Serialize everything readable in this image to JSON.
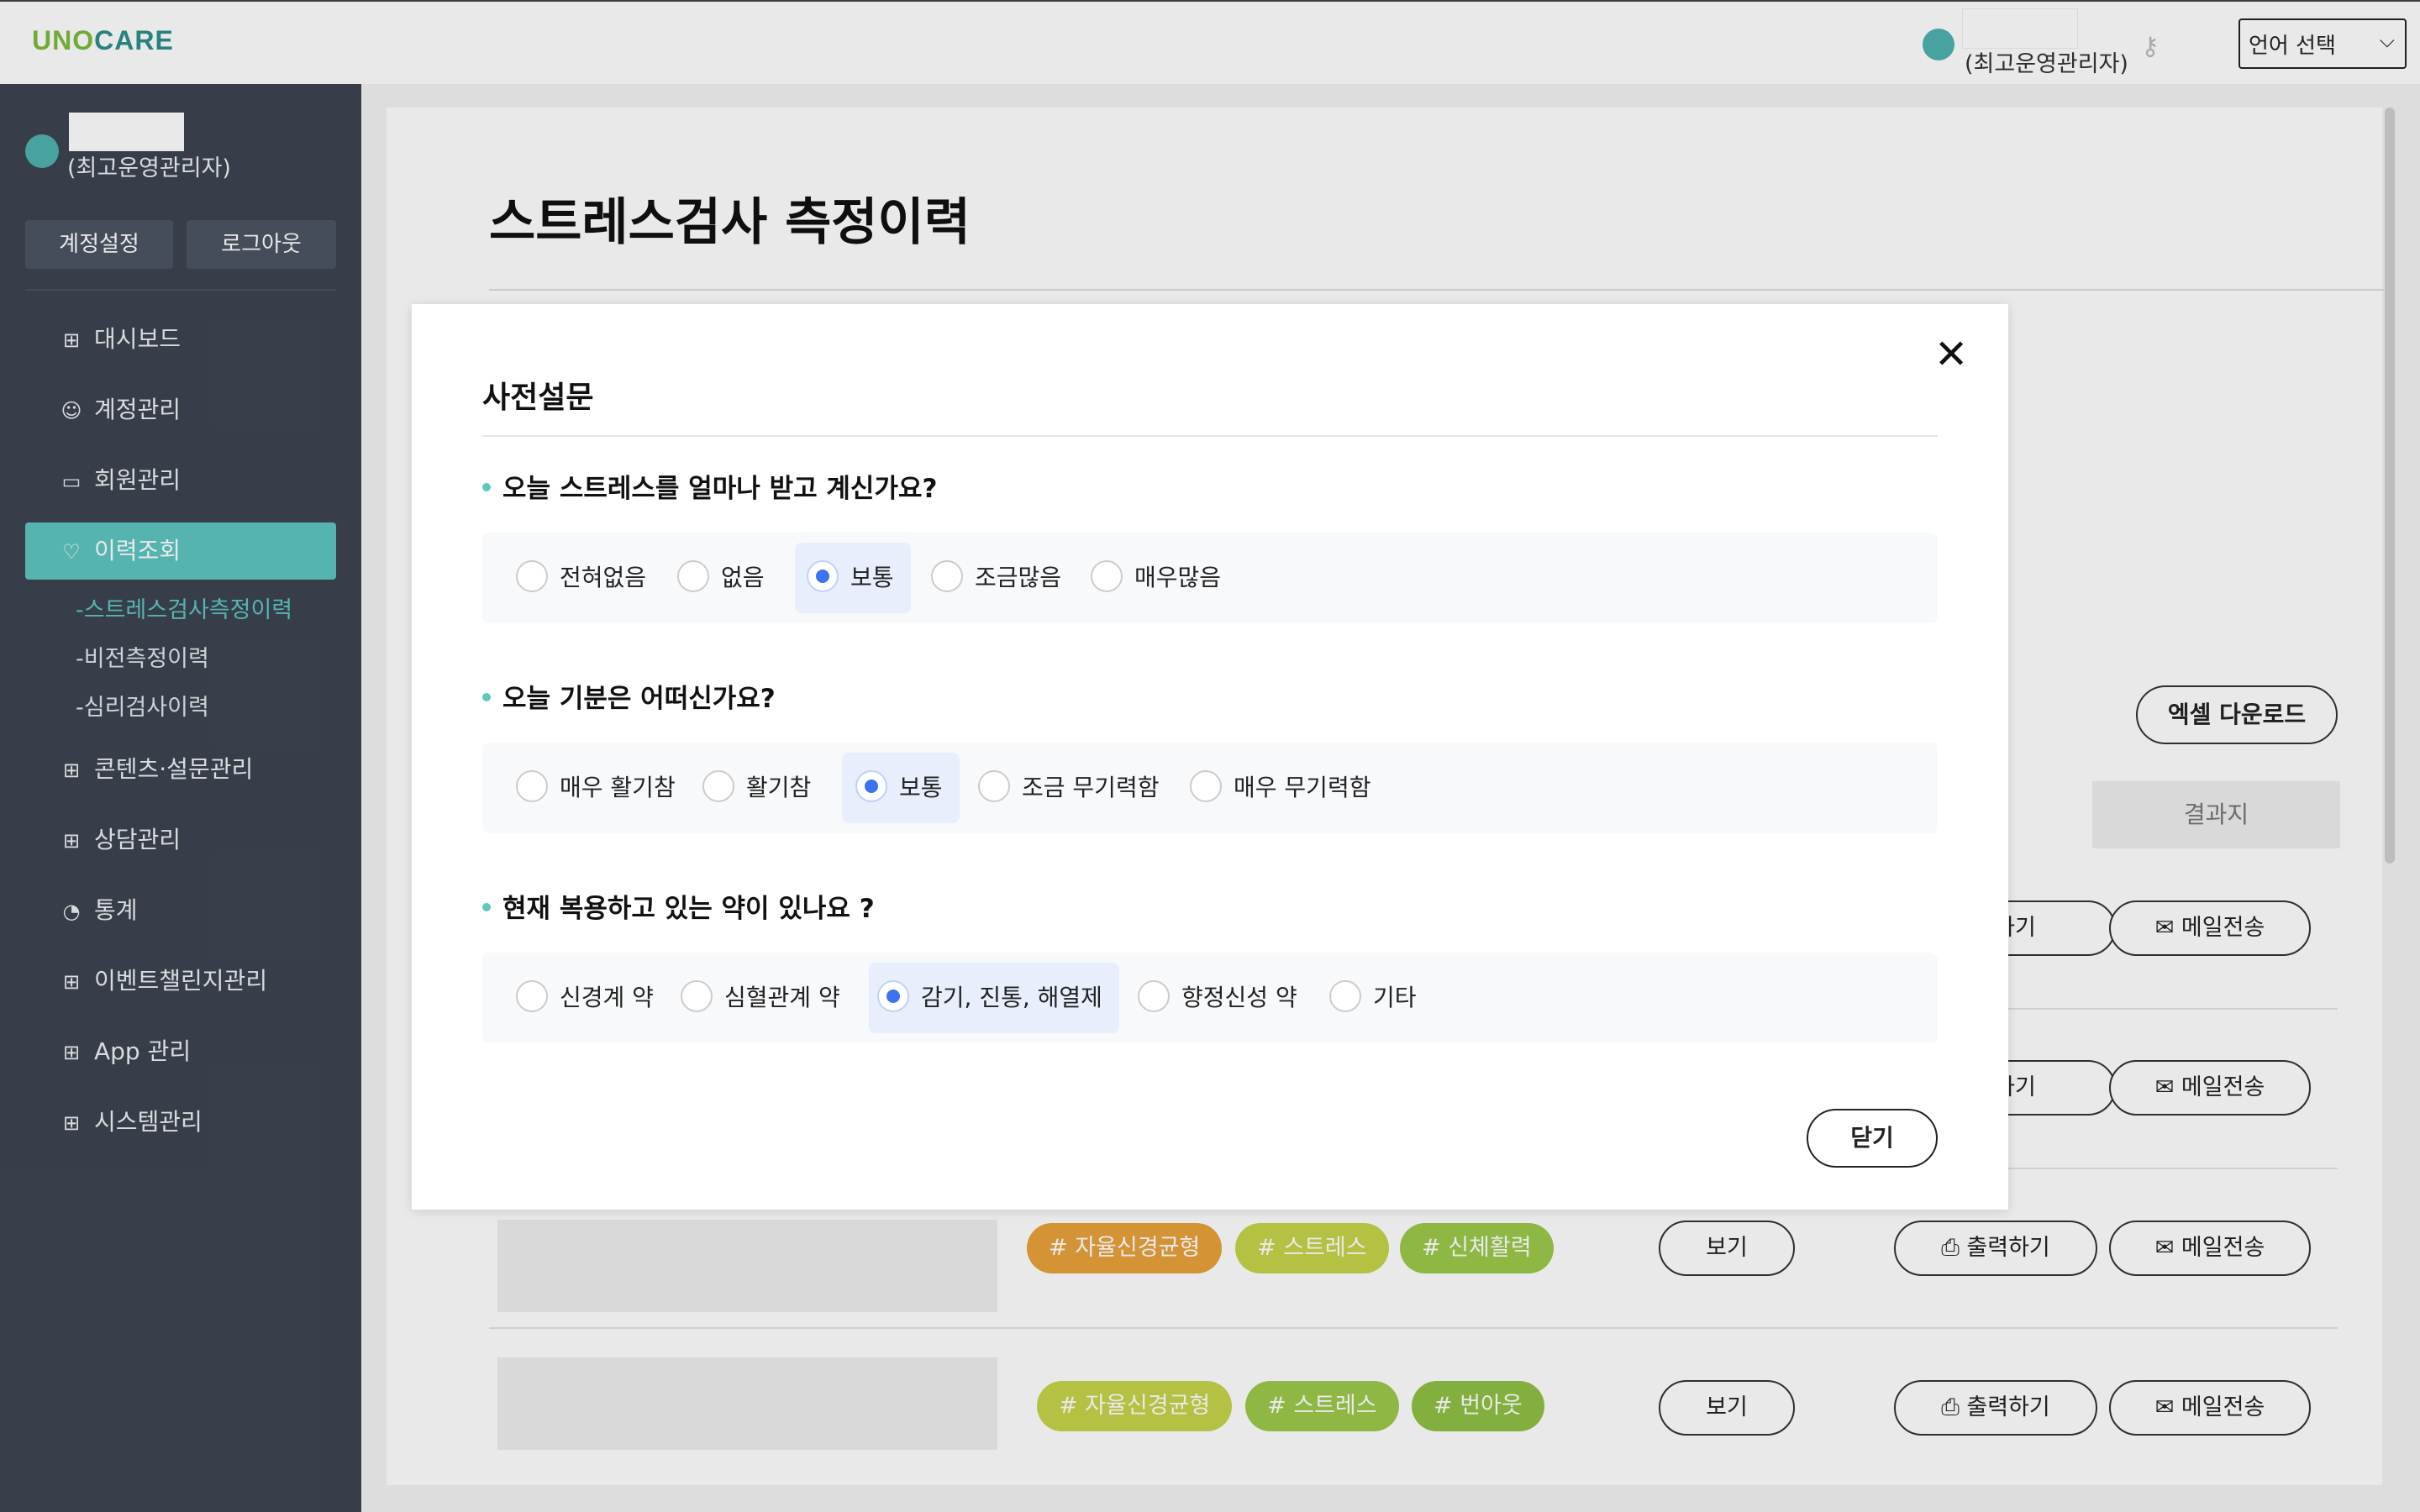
{
  "header": {
    "logo_part1": "UNO",
    "logo_part2": "CARE",
    "role": "(최고운영관리자)",
    "key_icon": "key-icon",
    "language_select": "언어 선택"
  },
  "sidebar": {
    "role": "(최고운영관리자)",
    "account_settings": "계정설정",
    "logout": "로그아웃",
    "items": [
      {
        "label": "대시보드",
        "icon": "grid-icon"
      },
      {
        "label": "계정관리",
        "icon": "smile-icon"
      },
      {
        "label": "회원관리",
        "icon": "folder-icon"
      },
      {
        "label": "이력조회",
        "icon": "heart-icon"
      },
      {
        "label": "콘텐츠·설문관리",
        "icon": "grid-icon"
      },
      {
        "label": "상담관리",
        "icon": "grid-icon"
      },
      {
        "label": "통계",
        "icon": "chart-icon"
      },
      {
        "label": "이벤트챌린지관리",
        "icon": "grid-icon"
      },
      {
        "label": "App 관리",
        "icon": "grid-icon"
      },
      {
        "label": "시스템관리",
        "icon": "grid-icon"
      }
    ],
    "subitems": [
      "-스트레스검사측정이력",
      "-비전측정이력",
      "-심리검사이력"
    ]
  },
  "main": {
    "title": "스트레스검사 측정이력",
    "excel_download": "엑셀 다운로드",
    "col_result": "결과지",
    "row_buttons": {
      "view": "보기",
      "print": "출력하기",
      "print_partial": "하기",
      "mail": "메일전송"
    },
    "rows": [
      {
        "tags": [
          "# 자율신경균형",
          "# 스트레스",
          "# 신체활력"
        ]
      },
      {
        "tags": [
          "# 자율신경균형",
          "# 스트레스",
          "# 번아웃"
        ]
      }
    ]
  },
  "modal": {
    "title": "사전설문",
    "close_label": "닫기",
    "questions": [
      {
        "label": "오늘 스트레스를 얼마나 받고 계신가요?",
        "options": [
          "전혀없음",
          "없음",
          "보통",
          "조금많음",
          "매우많음"
        ],
        "selected": "보통"
      },
      {
        "label": "오늘 기분은 어떠신가요?",
        "options": [
          "매우 활기참",
          "활기참",
          "보통",
          "조금 무기력함",
          "매우 무기력함"
        ],
        "selected": "보통"
      },
      {
        "label": "현재 복용하고 있는 약이 있나요 ?",
        "options": [
          "신경계 약",
          "심혈관계 약",
          "감기, 진통, 해열제",
          "향정신성 약",
          "기타"
        ],
        "selected": "감기, 진통, 해열제"
      }
    ]
  },
  "colors": {
    "sidebar_bg": "#3d4451",
    "accent": "#5fc5c1",
    "radio_selected": "#3b73f0",
    "tag_orange": "#e8a23a",
    "tag_lime": "#c7d44a",
    "tag_green": "#9cc94a"
  }
}
